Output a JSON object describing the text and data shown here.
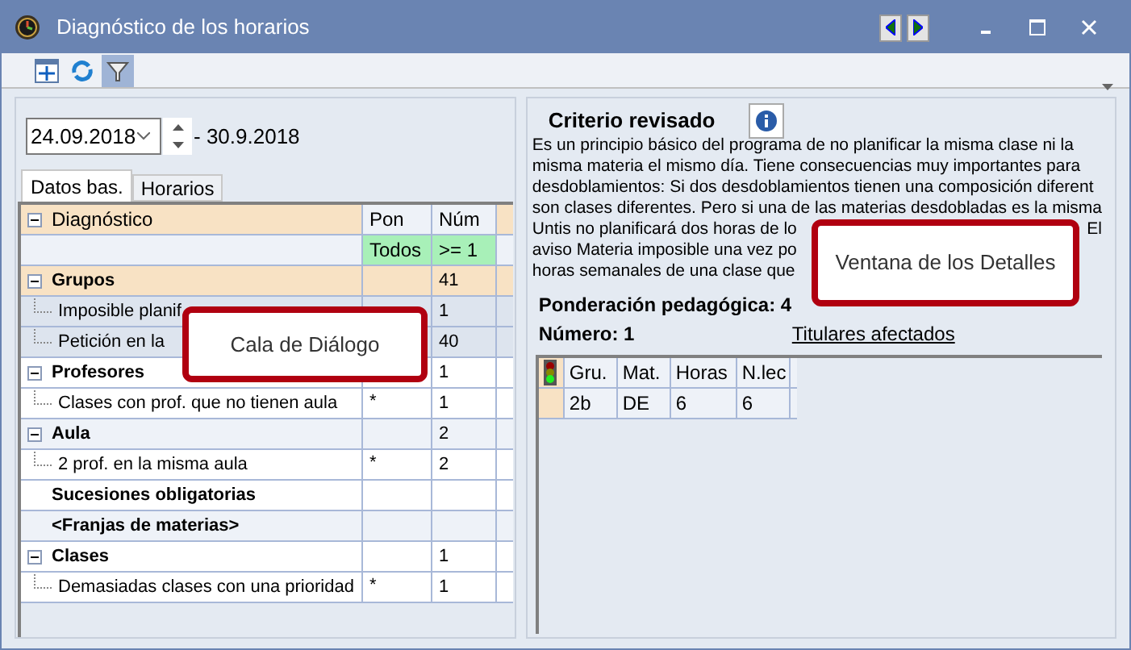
{
  "window": {
    "title": "Diagnóstico de los horarios"
  },
  "date_range": {
    "start": "24.09.2018",
    "end": "- 30.9.2018"
  },
  "tabs": [
    {
      "label": "Datos bas.",
      "selected": true
    },
    {
      "label": "Horarios",
      "selected": false
    }
  ],
  "diagnosis_table": {
    "columns": [
      "Diagnóstico",
      "Pon",
      "Núm"
    ],
    "filters": [
      "Todos",
      ">= 1"
    ],
    "rows": [
      {
        "label": "Grupos",
        "num": "41",
        "selected": true,
        "expander": true,
        "children": [
          {
            "label": "Imposible planif",
            "num": "1"
          },
          {
            "label": "Petición en la",
            "num": "40"
          }
        ]
      },
      {
        "label": "Profesores",
        "num": "1",
        "selected": false,
        "expander": true,
        "children": [
          {
            "label": "Clases con prof. que no tienen aula",
            "pon": "*",
            "num": "1"
          }
        ]
      },
      {
        "label": "Aula",
        "num": "2",
        "selected": false,
        "expander": true,
        "children": [
          {
            "label": "2 prof. en la misma aula",
            "pon": "*",
            "num": "2"
          }
        ]
      },
      {
        "label": "Sucesiones obligatorias",
        "selected": false,
        "expander": false,
        "children": []
      },
      {
        "label": "<Franjas de materias>",
        "selected": false,
        "expander": false,
        "children": []
      },
      {
        "label": "Clases",
        "num": "1",
        "selected": false,
        "expander": true,
        "children": [
          {
            "label": "Demasiadas clases con una prioridad",
            "pon": "*",
            "num": "1"
          }
        ]
      }
    ]
  },
  "details": {
    "title": "Criterio revisado",
    "description_lines": [
      {
        "text": "Es un principio básico del programa de no planificar la misma clase ni la"
      },
      {
        "text": "misma materia el mismo día. Tiene consecuencias muy importantes para"
      },
      {
        "text": "desdoblamientos: Si dos desdoblamientos tienen una composición diferent"
      },
      {
        "text": "son clases diferentes. Pero si una de las materias  desdobladas es la misma"
      },
      {
        "text": "Untis no planificará dos horas de lo",
        "tail": "El"
      },
      {
        "text": "aviso Materia imposible una vez po"
      },
      {
        "text": "horas semanales de una clase que"
      }
    ],
    "weight": "Ponderación pedagógica: 4",
    "number": "Número: 1",
    "link": "Titulares afectados",
    "grid": {
      "columns": [
        "Gru.",
        "Mat.",
        "Horas",
        "N.lec"
      ],
      "rows": [
        [
          "2b",
          "DE",
          "6",
          "6"
        ]
      ]
    }
  },
  "callouts": [
    {
      "text": "Cala de Diálogo"
    },
    {
      "text": "Ventana de los Detalles"
    }
  ]
}
